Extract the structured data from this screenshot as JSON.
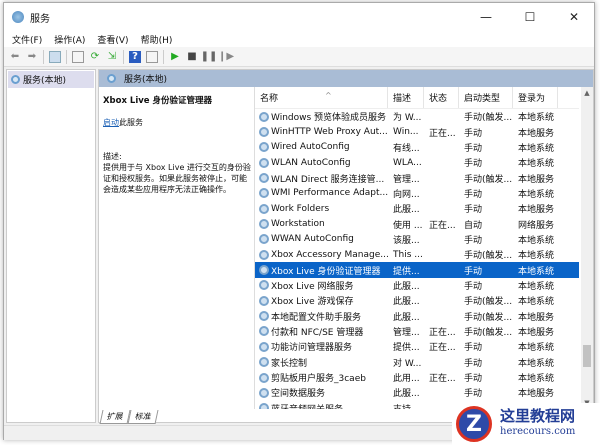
{
  "window": {
    "title": "服务",
    "minimize": "—",
    "maximize": "☐",
    "close": "✕"
  },
  "menu": [
    "文件(F)",
    "操作(A)",
    "查看(V)",
    "帮助(H)"
  ],
  "tree": {
    "item": "服务(本地)"
  },
  "panel": {
    "header": "服务(本地)"
  },
  "detail": {
    "name": "Xbox Live 身份验证管理器",
    "start_link": "启动",
    "start_suffix": "此服务",
    "desc_label": "描述:",
    "desc": "提供用于与 Xbox Live 进行交互的身份验证和授权服务。如果此服务被停止，可能会造成某些应用程序无法正确操作。"
  },
  "columns": [
    "名称",
    "描述",
    "状态",
    "启动类型",
    "登录为"
  ],
  "rows": [
    [
      "Windows 预览体验成员服务",
      "为 W...",
      "",
      "手动(触发...",
      "本地系统"
    ],
    [
      "WinHTTP Web Proxy Aut...",
      "Win...",
      "正在...",
      "手动",
      "本地服务"
    ],
    [
      "Wired AutoConfig",
      "有线...",
      "",
      "手动",
      "本地系统"
    ],
    [
      "WLAN AutoConfig",
      "WLA...",
      "",
      "手动",
      "本地系统"
    ],
    [
      "WLAN Direct 服务连接管...",
      "管理...",
      "",
      "手动(触发...",
      "本地服务"
    ],
    [
      "WMI Performance Adapt...",
      "向网...",
      "",
      "手动",
      "本地系统"
    ],
    [
      "Work Folders",
      "此服...",
      "",
      "手动",
      "本地服务"
    ],
    [
      "Workstation",
      "使用 ...",
      "正在...",
      "自动",
      "网络服务"
    ],
    [
      "WWAN AutoConfig",
      "该服...",
      "",
      "手动",
      "本地系统"
    ],
    [
      "Xbox Accessory Manage...",
      "This ...",
      "",
      "手动(触发...",
      "本地系统"
    ],
    [
      "Xbox Live 身份验证管理器",
      "提供...",
      "",
      "手动",
      "本地系统"
    ],
    [
      "Xbox Live 网络服务",
      "此服...",
      "",
      "手动",
      "本地系统"
    ],
    [
      "Xbox Live 游戏保存",
      "此服...",
      "",
      "手动(触发...",
      "本地系统"
    ],
    [
      "本地配置文件助手服务",
      "此服...",
      "",
      "手动(触发...",
      "本地服务"
    ],
    [
      "付款和 NFC/SE 管理器",
      "管理...",
      "正在...",
      "手动(触发...",
      "本地服务"
    ],
    [
      "功能访问管理器服务",
      "提供...",
      "正在...",
      "手动",
      "本地系统"
    ],
    [
      "家长控制",
      "对 W...",
      "",
      "手动",
      "本地系统"
    ],
    [
      "剪贴板用户服务_3caeb",
      "此用...",
      "正在...",
      "手动",
      "本地系统"
    ],
    [
      "空间数据服务",
      "此服...",
      "",
      "手动",
      "本地服务"
    ],
    [
      "蓝牙音频网关服务",
      "支持...",
      "",
      "",
      ""
    ]
  ],
  "selected_index": 10,
  "tabs": [
    "扩展",
    "标准"
  ],
  "watermark": {
    "name": "这里教程网",
    "url": "herecours.com",
    "logo": "Z"
  }
}
